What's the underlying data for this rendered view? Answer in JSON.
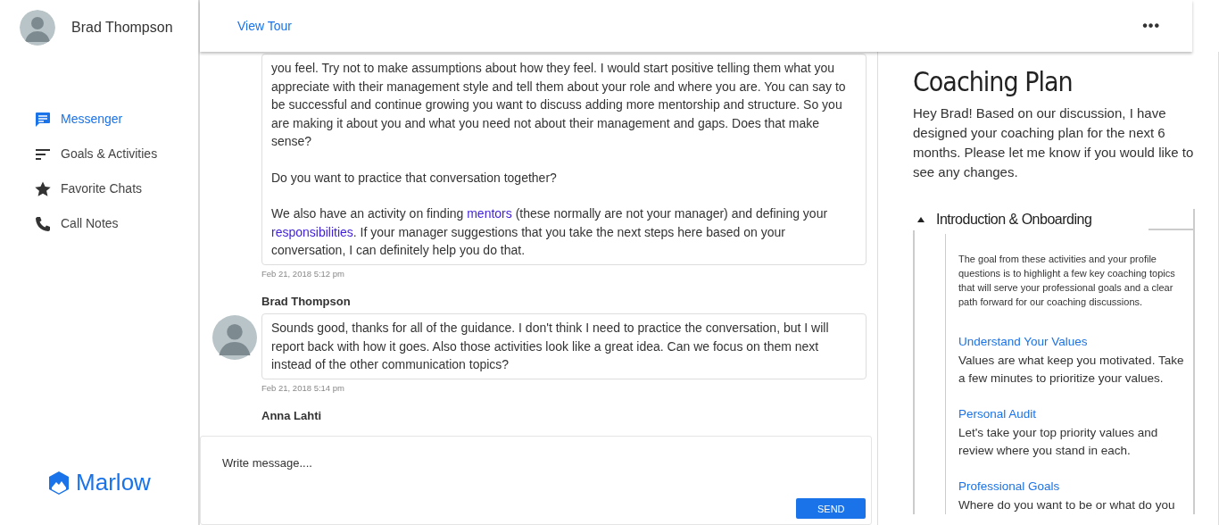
{
  "user": {
    "name": "Brad Thompson"
  },
  "nav": [
    {
      "label": "Messenger",
      "selected": true
    },
    {
      "label": "Goals & Activities",
      "selected": false
    },
    {
      "label": "Favorite Chats",
      "selected": false
    },
    {
      "label": "Call Notes",
      "selected": false
    }
  ],
  "brand": "Marlow",
  "header": {
    "link": "View Tour",
    "menu": "•••"
  },
  "messages": [
    {
      "avatar": false,
      "paragraphs": [
        [
          {
            "text": "you feel. Try not to make assumptions about how they feel. I would start positive telling them what you appreciate with their management style and tell them about your role and where you are. You can say to be successful and continue growing you want to discuss adding more mentorship and structure. So you are making it about you and what you need not about their management and gaps. Does that make sense?"
          }
        ],
        [
          {
            "text": "Do you want to practice that conversation together?"
          }
        ],
        [
          {
            "text": "We also have an activity on finding "
          },
          {
            "text": "mentors",
            "link": true
          },
          {
            "text": " (these normally are not your manager) and defining your "
          },
          {
            "text": "responsibilities",
            "link": true
          },
          {
            "text": ". If your manager suggestions that you take the next steps here based on your conversation, I can definitely help you do that."
          }
        ]
      ],
      "time": "Feb 21, 2018 5:12 pm"
    },
    {
      "sender": "Brad Thompson",
      "avatar": true,
      "paragraphs": [
        [
          {
            "text": "Sounds good, thanks for all of the guidance. I don't think I need to practice the conversation, but I will report back with how it goes. Also those activities look like a great idea. Can we focus on them next instead of the other communication topics?"
          }
        ]
      ],
      "time": "Feb 21, 2018 5:14 pm"
    },
    {
      "sender": "Anna Lahti",
      "avatar": false
    }
  ],
  "composer": {
    "placeholder": "Write message....",
    "button": "SEND"
  },
  "plan": {
    "title": "Coaching Plan",
    "intro": "Hey Brad! Based on our discussion, I have designed your coaching plan for the next 6 months. Please let me know if you would like to see any changes.",
    "sections": [
      {
        "title": "Introduction & Onboarding",
        "expanded": true,
        "summary": "The goal from these activities and your profile questions is to highlight a few key coaching topics that will serve your professional goals and a clear path forward for our coaching discussions.",
        "activities": [
          {
            "title": "Understand Your Values",
            "description": "Values are what keep you motivated. Take a few minutes to prioritize your values."
          },
          {
            "title": "Personal Audit",
            "description": "Let's take your top priority values and review where you stand in each."
          },
          {
            "title": "Professional Goals",
            "description": "Where do you want to be or what do you"
          }
        ]
      }
    ]
  }
}
